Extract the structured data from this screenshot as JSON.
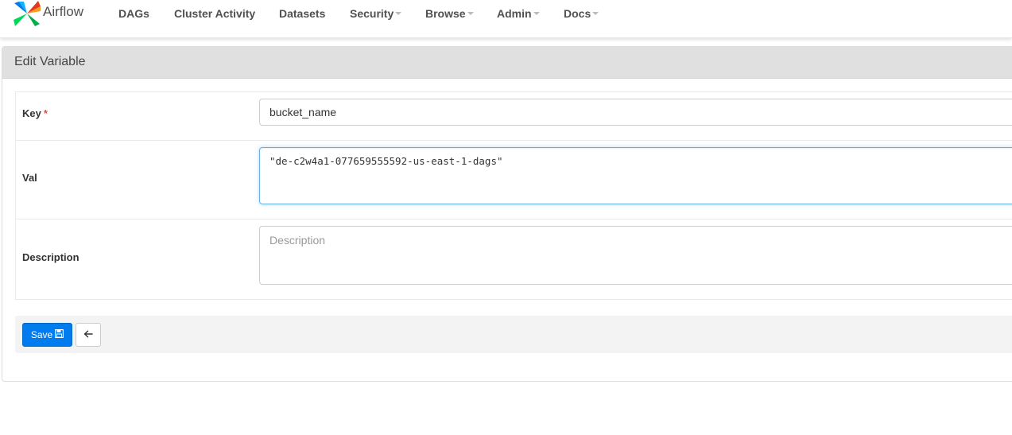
{
  "brand": {
    "name": "Airflow",
    "icon": "airflow-pinwheel-logo"
  },
  "nav": {
    "items": [
      {
        "label": "DAGs",
        "dropdown": false
      },
      {
        "label": "Cluster Activity",
        "dropdown": false
      },
      {
        "label": "Datasets",
        "dropdown": false
      },
      {
        "label": "Security",
        "dropdown": true
      },
      {
        "label": "Browse",
        "dropdown": true
      },
      {
        "label": "Admin",
        "dropdown": true
      },
      {
        "label": "Docs",
        "dropdown": true
      }
    ]
  },
  "panel": {
    "title": "Edit Variable"
  },
  "form": {
    "key": {
      "label": "Key",
      "required_marker": "*",
      "value": "bucket_name"
    },
    "val": {
      "label": "Val",
      "value": "\"de-c2w4a1-077659555592-us-east-1-dags\""
    },
    "description": {
      "label": "Description",
      "value": "",
      "placeholder": "Description"
    }
  },
  "actions": {
    "save_label": "Save",
    "save_icon": "floppy-disk-icon",
    "back_icon": "arrow-left-icon"
  },
  "colors": {
    "primary": "#017cee",
    "nav_text": "#51504f",
    "panel_heading_bg": "#e0e0e0",
    "required": "#d9534f",
    "focus_border": "#66afe9"
  }
}
